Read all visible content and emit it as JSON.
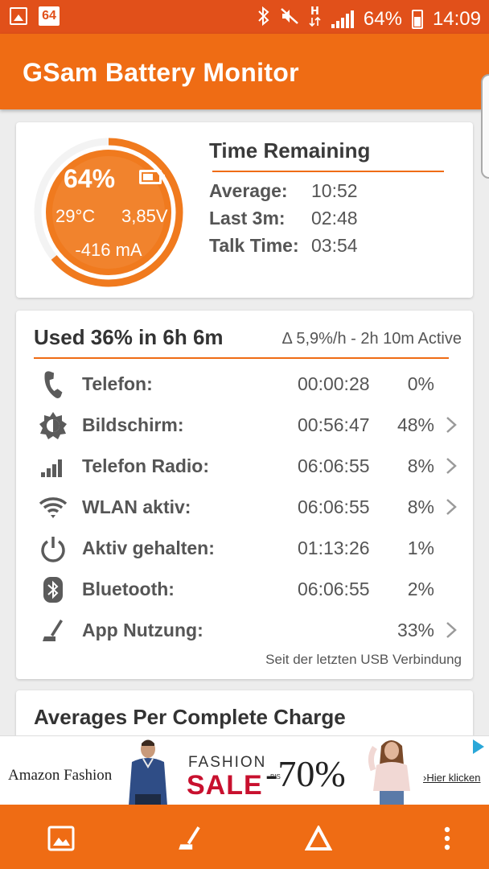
{
  "status_bar": {
    "notification_badge": "64",
    "battery_percent": "64%",
    "time": "14:09",
    "icons": [
      "image-icon",
      "bluetooth-icon",
      "mute-icon",
      "h-data-icon",
      "signal-icon",
      "battery-icon"
    ]
  },
  "app": {
    "title": "GSam Battery Monitor"
  },
  "gauge": {
    "percent": "64%",
    "temperature": "29°C",
    "voltage": "3,85V",
    "current": "-416 mA",
    "level": 0.64,
    "fill_color": "#f07a1e",
    "ring_color": "#f07a1e"
  },
  "time_remaining": {
    "title": "Time Remaining",
    "rows": [
      {
        "label": "Average:",
        "value": "10:52"
      },
      {
        "label": "Last 3m:",
        "value": "02:48"
      },
      {
        "label": "Talk Time:",
        "value": "03:54"
      }
    ]
  },
  "usage": {
    "title": "Used 36% in 6h 6m",
    "rate": "Δ 5,9%/h - 2h 10m Active",
    "rows": [
      {
        "icon": "phone-icon",
        "name": "Telefon:",
        "time": "00:00:28",
        "percent": "0%",
        "has_detail": false
      },
      {
        "icon": "screen-brightness-icon",
        "name": "Bildschirm:",
        "time": "00:56:47",
        "percent": "48%",
        "has_detail": true
      },
      {
        "icon": "signal-bars-icon",
        "name": "Telefon Radio:",
        "time": "06:06:55",
        "percent": "8%",
        "has_detail": true
      },
      {
        "icon": "wifi-icon",
        "name": "WLAN aktiv:",
        "time": "06:06:55",
        "percent": "8%",
        "has_detail": true
      },
      {
        "icon": "power-icon",
        "name": "Aktiv gehalten:",
        "time": "01:13:26",
        "percent": "1%",
        "has_detail": false
      },
      {
        "icon": "bluetooth-icon",
        "name": "Bluetooth:",
        "time": "06:06:55",
        "percent": "2%",
        "has_detail": false
      },
      {
        "icon": "app-usage-icon",
        "name": "App Nutzung:",
        "time": "",
        "percent": "33%",
        "has_detail": true
      }
    ],
    "footnote": "Seit der letzten USB Verbindung"
  },
  "averages": {
    "title": "Averages Per Complete Charge"
  },
  "ad": {
    "brand": "Amazon Fashion",
    "line1": "FASHION",
    "sale": "SALE",
    "bis": "BIS",
    "discount": "-70%",
    "cta": "›Hier klicken"
  },
  "bottom_bar": {
    "buttons": [
      "gallery-icon",
      "app-usage-icon",
      "delta-icon",
      "more-vert-icon"
    ]
  },
  "colors": {
    "status_bar": "#e1501a",
    "app_bar": "#ef6c14",
    "accent": "#ef6c14",
    "background": "#ededed"
  }
}
